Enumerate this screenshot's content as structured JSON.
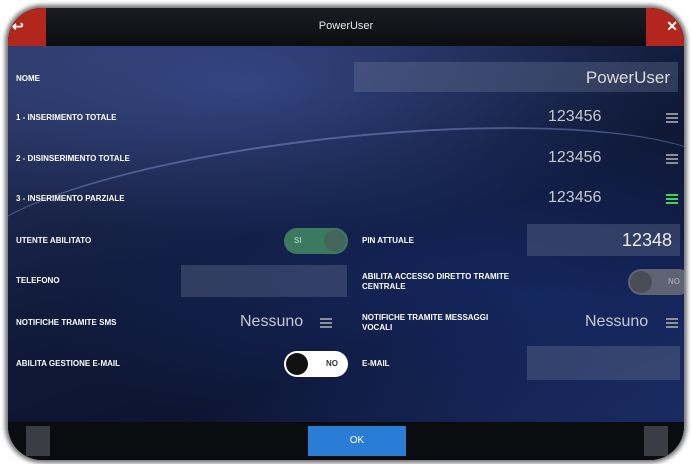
{
  "window": {
    "title": "PowerUser"
  },
  "form": {
    "nome_label": "NOME",
    "nome_value": "PowerUser",
    "rows": [
      {
        "label": "1 - INSERIMENTO TOTALE",
        "code": "123456",
        "icon": "menu-icon-gray"
      },
      {
        "label": "2 - DISINSERIMENTO TOTALE",
        "code": "123456",
        "icon": "menu-icon-gray"
      },
      {
        "label": "3 - INSERIMENTO PARZIALE",
        "code": "123456",
        "icon": "menu-icon-green"
      }
    ],
    "utente_abilitato_label": "UTENTE ABILITATO",
    "utente_abilitato_toggle": "SI",
    "pin_attuale_label": "PIN ATTUALE",
    "pin_attuale_value": "12348",
    "telefono_label": "TELEFONO",
    "telefono_value": "",
    "accesso_diretto_label": "ABILITA ACCESSO DIRETTO TRAMITE CENTRALE",
    "accesso_diretto_toggle": "NO",
    "notifiche_sms_label": "NOTIFICHE TRAMITE SMS",
    "notifiche_sms_value": "Nessuno",
    "notifiche_vocali_label": "NOTIFICHE TRAMITE MESSAGGI VOCALI",
    "notifiche_vocali_value": "Nessuno",
    "email_gestione_label": "ABILITA GESTIONE E-MAIL",
    "email_gestione_toggle": "NO",
    "email_label": "E-MAIL",
    "email_value": ""
  },
  "footer": {
    "ok_label": "OK"
  },
  "colors": {
    "accent": "#2a7dd4",
    "close_red": "#b3261e",
    "green": "#3fd45c",
    "toggle_on": "#3c7a5f"
  }
}
